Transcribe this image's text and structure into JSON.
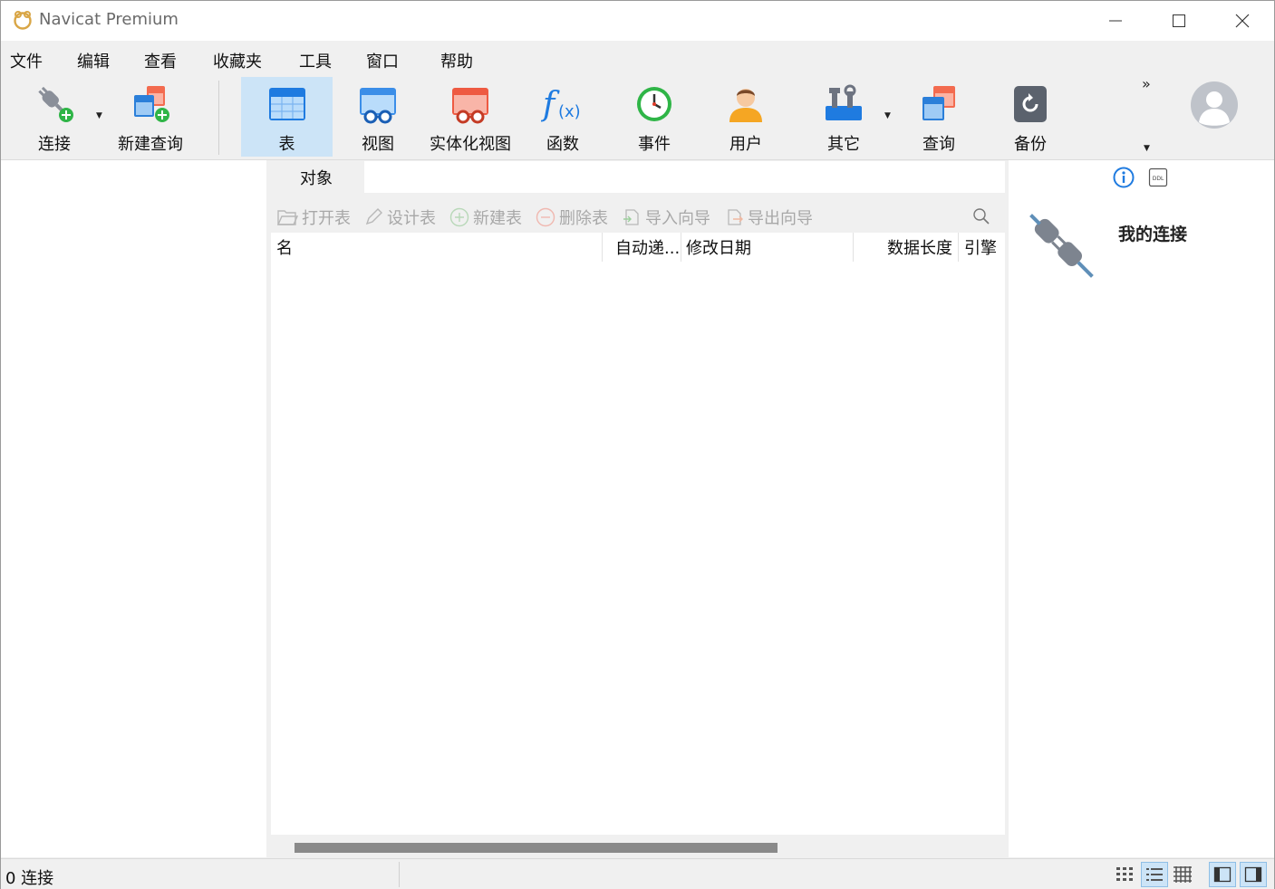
{
  "window": {
    "title": "Navicat Premium"
  },
  "menu": [
    "文件",
    "编辑",
    "查看",
    "收藏夹",
    "工具",
    "窗口",
    "帮助"
  ],
  "toolbar": {
    "connect": "连接",
    "new_query": "新建查询",
    "table": "表",
    "view": "视图",
    "materialized_view": "实体化视图",
    "function": "函数",
    "event": "事件",
    "user": "用户",
    "others": "其它",
    "query": "查询",
    "backup": "备份",
    "more": "»"
  },
  "tabs": {
    "objects": "对象"
  },
  "object_toolbar": {
    "open_table": "打开表",
    "design_table": "设计表",
    "new_table": "新建表",
    "delete_table": "删除表",
    "import_wizard": "导入向导",
    "export_wizard": "导出向导"
  },
  "columns": [
    "名",
    "自动递...",
    "修改日期",
    "数据长度",
    "引擎"
  ],
  "right_panel": {
    "title": "我的连接"
  },
  "status": {
    "connections": "0 连接"
  },
  "colors": {
    "accent": "#0078d7",
    "selected": "#cce4f7"
  }
}
